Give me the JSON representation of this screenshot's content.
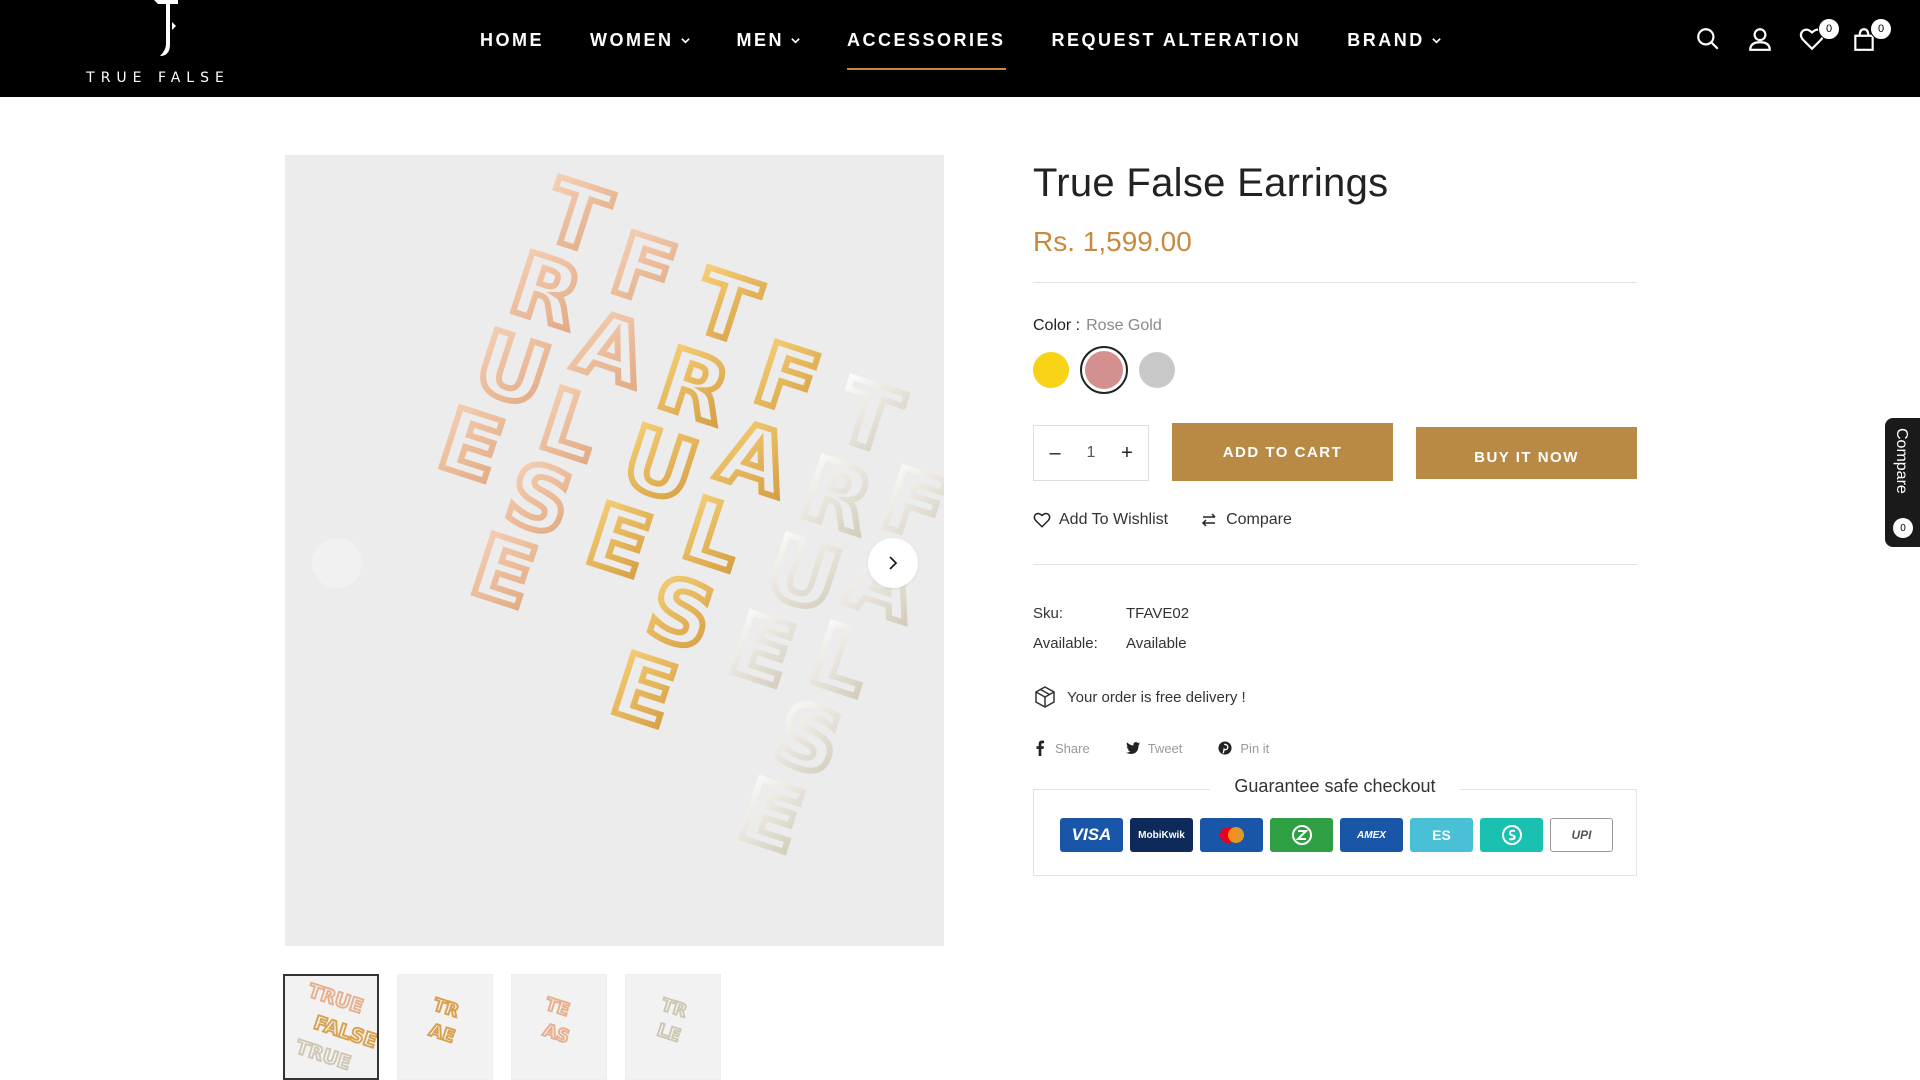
{
  "brand": {
    "logo_text": "TRUE FALSE"
  },
  "nav": {
    "items": [
      {
        "label": "HOME",
        "dropdown": false
      },
      {
        "label": "WOMEN",
        "dropdown": true
      },
      {
        "label": "MEN",
        "dropdown": true
      },
      {
        "label": "ACCESSORIES",
        "dropdown": false,
        "active": true
      },
      {
        "label": "REQUEST ALTERATION",
        "dropdown": false
      },
      {
        "label": "BRAND",
        "dropdown": true
      }
    ]
  },
  "header_icons": {
    "icons": [
      "search-icon",
      "account-icon",
      "wishlist-icon",
      "cart-icon"
    ],
    "wishlist_count": "0",
    "cart_count": "0"
  },
  "colors": {
    "header_bg": "#000000",
    "accent": "#c8893f",
    "button": "#b88a45"
  },
  "product": {
    "title": "True False Earrings",
    "price": "Rs. 1,599.00",
    "color_label": "Color :",
    "color_value": "Rose Gold",
    "swatches": [
      {
        "name": "Gold",
        "hex": "#f7d215",
        "selected": false
      },
      {
        "name": "Rose Gold",
        "hex": "#d48f8f",
        "selected": true
      },
      {
        "name": "Silver",
        "hex": "#c8c8c8",
        "selected": false
      }
    ],
    "quantity": "1",
    "add_to_cart": "ADD TO CART",
    "buy_now": "BUY IT NOW",
    "wishlist": "Add To Wishlist",
    "compare": "Compare",
    "sku_label": "Sku:",
    "sku": "TFAVE02",
    "available_label": "Available:",
    "available": "Available",
    "delivery": "Your order is free delivery !"
  },
  "share": {
    "facebook": "Share",
    "twitter": "Tweet",
    "pinterest": "Pin it"
  },
  "guarantee": {
    "title": "Guarantee safe checkout",
    "methods": [
      {
        "name": "VISA",
        "color": "#1a56a8"
      },
      {
        "name": "MobiKwik",
        "color": "#0e2a5a"
      },
      {
        "name": "mastercard",
        "color": "#1a56a8"
      },
      {
        "name": "Z",
        "color": "#2ea043"
      },
      {
        "name": "AMEX",
        "color": "#1a56a8"
      },
      {
        "name": "ES",
        "color": "#49c0d6"
      },
      {
        "name": "S",
        "color": "#1bc1b0"
      },
      {
        "name": "UPI",
        "color": "#ffffff"
      }
    ]
  },
  "compare_tab": {
    "label": "Compare",
    "count": "0"
  },
  "gallery": {
    "thumbnails": 4,
    "active": 0
  }
}
